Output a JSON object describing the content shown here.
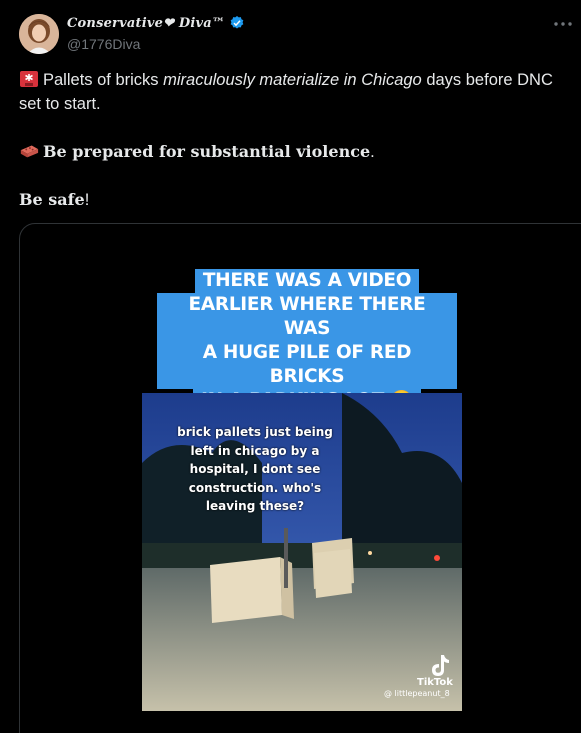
{
  "author": {
    "display_name": "Conservative❤ Diva™",
    "handle": "@1776Diva",
    "avatar_icon": "avatar-photo"
  },
  "tweet": {
    "line1_pre": "Pallets of bricks ",
    "line1_italic": "miraculously materialize in Chicago",
    "line1_post": " days before DNC set to start.",
    "line2_bold": "Be prepared for substantial violence",
    "line2_tail": ".",
    "line3_bold": "Be safe",
    "line3_tail": "!"
  },
  "media": {
    "caption_lines": [
      "THERE WAS A VIDEO",
      "EARLIER WHERE THERE WAS",
      "A HUGE PILE OF RED BRICKS",
      "IN A PARKING LOT 😬"
    ],
    "video_text": [
      "brick pallets just being",
      "left in chicago by a",
      "hospital, I dont see",
      "construction. who's",
      "leaving these?"
    ],
    "tiktok_label": "TikTok",
    "tiktok_user": "@ littlepeanut_8"
  },
  "colors": {
    "background": "#000000",
    "text": "#e7e9ea",
    "secondary": "#71767b",
    "caption_bg": "#3a96e6",
    "verified": "#1d9bf0"
  }
}
